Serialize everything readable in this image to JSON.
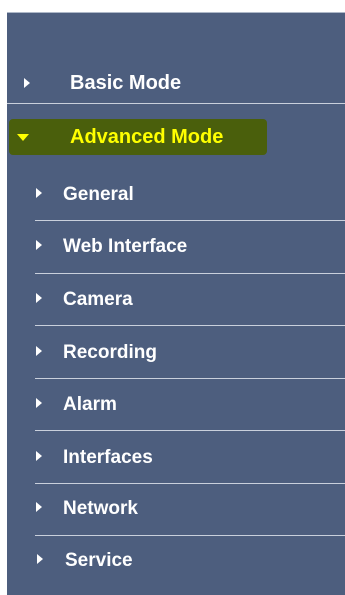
{
  "menu": {
    "modes": [
      {
        "label": "Basic Mode",
        "expanded": false
      },
      {
        "label": "Advanced Mode",
        "expanded": true
      }
    ],
    "advanced_items": [
      {
        "label": "General"
      },
      {
        "label": "Web Interface"
      },
      {
        "label": "Camera"
      },
      {
        "label": "Recording"
      },
      {
        "label": "Alarm"
      },
      {
        "label": "Interfaces"
      },
      {
        "label": "Network"
      },
      {
        "label": "Service"
      }
    ]
  },
  "colors": {
    "panel_bg": "#4d5e7e",
    "highlight_bg": "#4a5f0c",
    "highlight_text": "#ffff00",
    "text": "#ffffff"
  }
}
